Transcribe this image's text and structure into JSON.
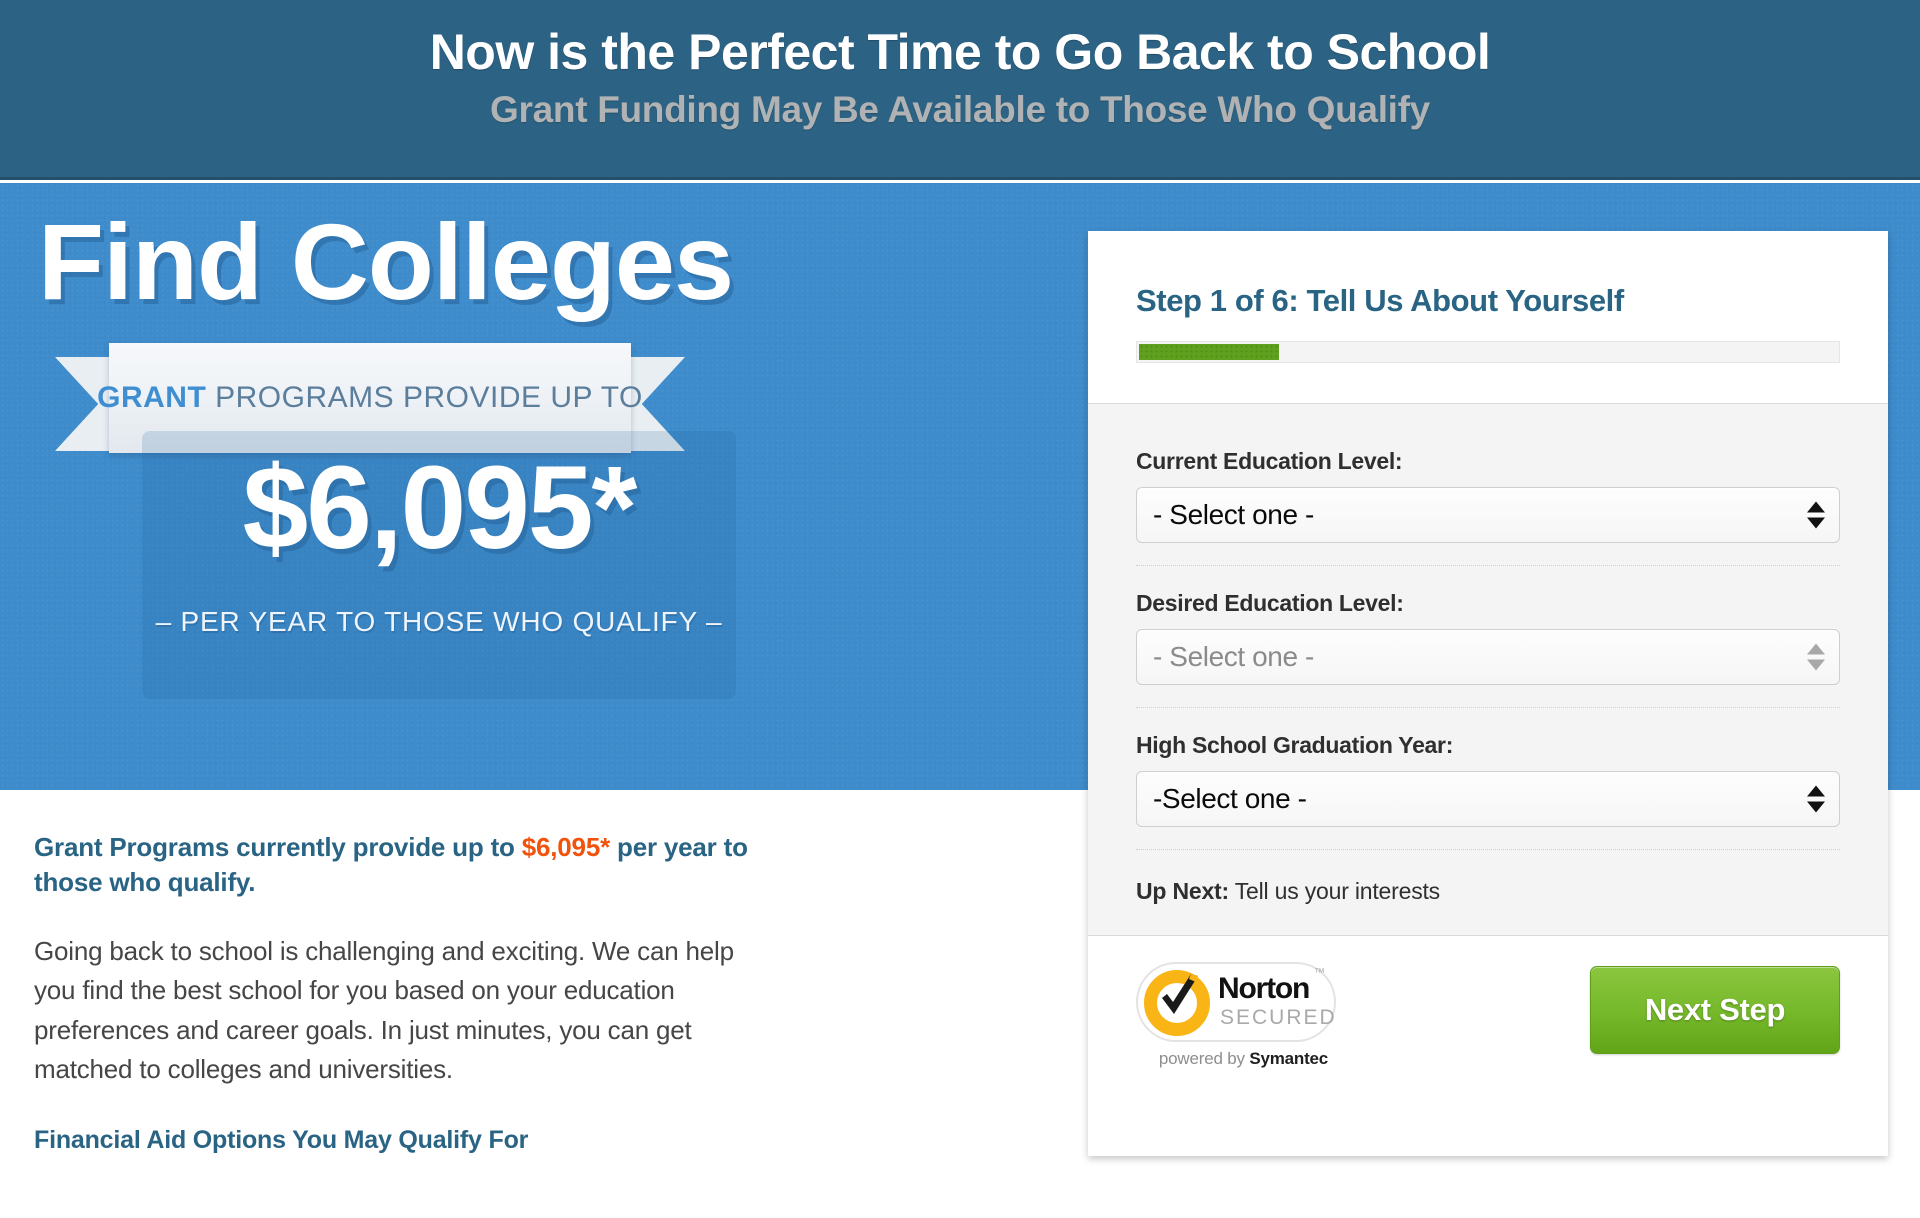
{
  "banner": {
    "title": "Now is the Perfect Time to Go Back to School",
    "subtitle": "Grant Funding May Be Available to Those Who Qualify",
    "bg_color": "#2c6283",
    "title_color": "#ffffff",
    "subtitle_color": "#b0b2b4"
  },
  "hero": {
    "headline": "Find Colleges",
    "ribbon_strong": "GRANT",
    "ribbon_rest": " PROGRAMS PROVIDE UP TO",
    "amount": "$6,095*",
    "amount_caption": "– PER YEAR TO THOSE WHO QUALIFY –",
    "bg_color": "#3e8ccc",
    "accent_color": "#3f8ed2"
  },
  "article": {
    "lede_before": "Grant Programs currently provide up to ",
    "lede_money": "$6,095*",
    "lede_after": " per year to those who qualify.",
    "paragraph": "Going back to school is challenging and exciting. We can help you find the best school for you based on your education preferences and career goals. In just minutes, you can get matched to colleges and universities.",
    "subheading": "Financial Aid Options You May Qualify For",
    "lede_color": "#2a6484",
    "money_color": "#f1530d"
  },
  "form": {
    "step_title": "Step 1 of 6: Tell Us About Yourself",
    "current_step": 1,
    "total_steps": 6,
    "progress_percent": 20,
    "progress_fill_color": "#5fa01e",
    "progress_track_color": "#f4f4f4",
    "fields": [
      {
        "label": "Current Education Level:",
        "value": "- Select one -",
        "disabled": false
      },
      {
        "label": "Desired Education Level:",
        "value": "- Select one -",
        "disabled": true
      },
      {
        "label": "High School Graduation Year:",
        "value": "-Select one -",
        "disabled": false
      }
    ],
    "up_next_label": "Up Next:",
    "up_next_value": " Tell us your interests",
    "submit_label": "Next Step",
    "submit_color": "#76b92b"
  },
  "trust_badge": {
    "brand": "Norton",
    "status": "SECURED",
    "trademark": "™",
    "powered_prefix": "powered by ",
    "powered_brand": "Symantec",
    "ring_color": "#f9b416"
  }
}
